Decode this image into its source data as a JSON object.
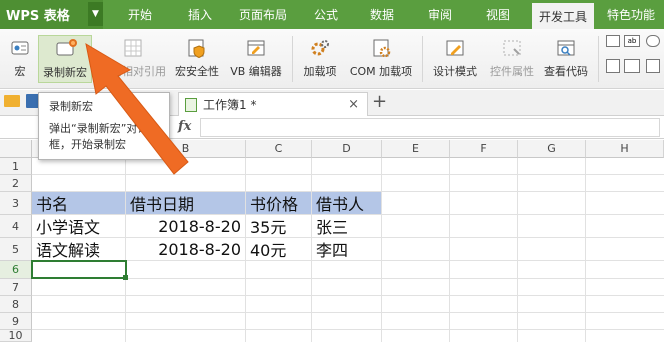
{
  "app": {
    "name": "WPS 表格"
  },
  "menu_tabs": [
    "开始",
    "插入",
    "页面布局",
    "公式",
    "数据",
    "审阅",
    "视图",
    "开发工具",
    "特色功能"
  ],
  "active_tab": "开发工具",
  "ribbon": {
    "macro": "宏",
    "record_macro": "录制新宏",
    "relative_ref": "使用相对引用",
    "macro_security": "宏安全性",
    "vb_editor": "VB 编辑器",
    "addins": "加载项",
    "com_addins": "COM 加载项",
    "design_mode": "设计模式",
    "control_props": "控件属性",
    "view_code": "查看代码"
  },
  "tooltip": {
    "title": "录制新宏",
    "line1": "弹出“录制新宏”对话",
    "line2": "框，开始录制宏"
  },
  "sheet_tab": {
    "label": "工作簿1 *",
    "close": "×",
    "add": "+"
  },
  "formula": {
    "fx": "fx"
  },
  "columns": [
    "A",
    "B",
    "C",
    "D",
    "E",
    "F",
    "G",
    "H"
  ],
  "rows": [
    "1",
    "2",
    "3",
    "4",
    "5",
    "6",
    "7",
    "8",
    "9",
    "10"
  ],
  "selected_row": "6",
  "table": {
    "headers": [
      "书名",
      "借书日期",
      "书价格",
      "借书人"
    ],
    "rows": [
      [
        "小学语文",
        "2018-8-20",
        "35元",
        "张三"
      ],
      [
        "语文解读",
        "2018-8-20",
        "40元",
        "李四"
      ]
    ]
  },
  "colors": {
    "accent": "#5a9e3f",
    "header_fill": "#b4c6e7",
    "arrow": "#ef6b24"
  }
}
